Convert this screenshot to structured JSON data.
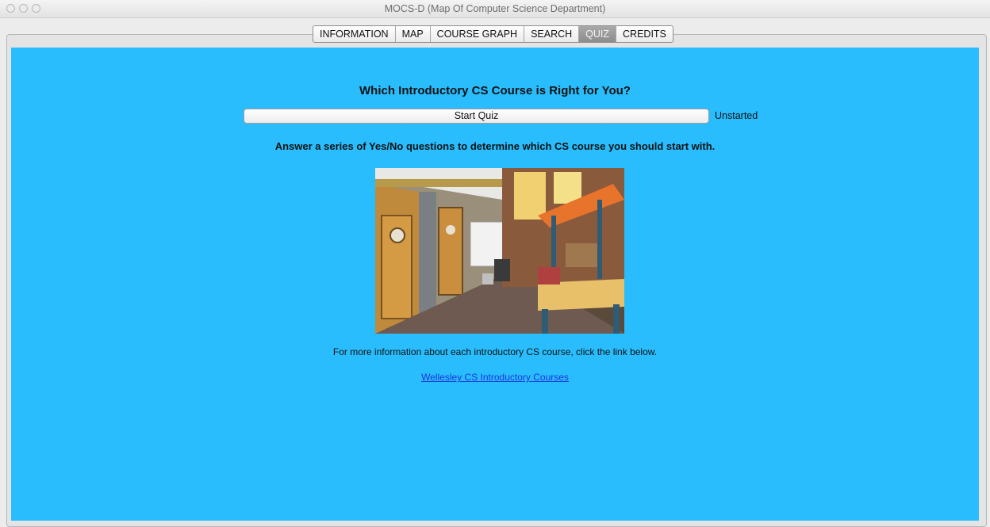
{
  "window": {
    "title": "MOCS-D (Map Of Computer Science Department)"
  },
  "tabs": [
    {
      "label": "INFORMATION",
      "selected": false
    },
    {
      "label": "MAP",
      "selected": false
    },
    {
      "label": "COURSE GRAPH",
      "selected": false
    },
    {
      "label": "SEARCH",
      "selected": false
    },
    {
      "label": "QUIZ",
      "selected": true
    },
    {
      "label": "CREDITS",
      "selected": false
    }
  ],
  "quiz": {
    "heading": "Which Introductory CS Course is Right for You?",
    "start_button": "Start Quiz",
    "status": "Unstarted",
    "subtitle": "Answer a series of Yes/No questions to determine which CS course you should start with.",
    "info_text": "For more information about each introductory CS course, click the link below.",
    "link_text": "Wellesley CS Introductory Courses"
  },
  "colors": {
    "content_background": "#29bdfd",
    "link": "#1a36d8",
    "selected_tab": "#8d8d8d"
  }
}
